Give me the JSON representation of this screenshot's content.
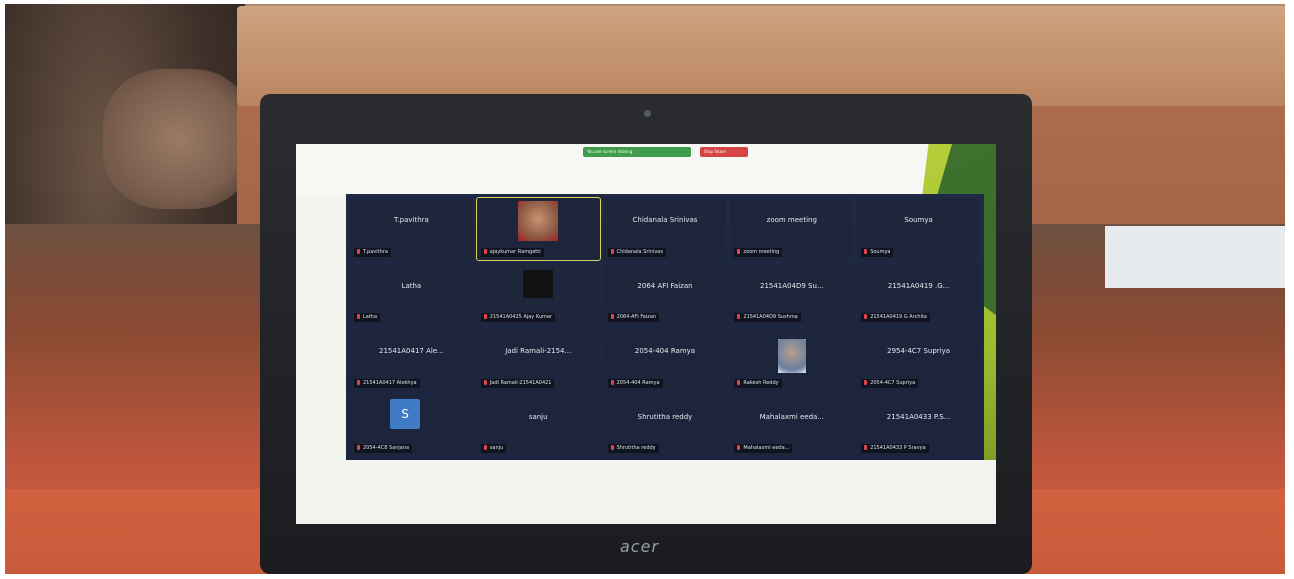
{
  "laptop": {
    "brand": "acer"
  },
  "toolbar": {
    "share_status": "You are screen sharing",
    "stop_share": "Stop Share"
  },
  "participants": [
    {
      "name": "T.pavithra",
      "label": "T.pavithra",
      "video": false
    },
    {
      "name": "",
      "label": "ajaykumar Ramgatti",
      "video": true,
      "active": true
    },
    {
      "name": "Chidanala Srinivas",
      "label": "Chidanala Srinivas",
      "video": false
    },
    {
      "name": "zoom meeting",
      "label": "zoom meeting",
      "video": false
    },
    {
      "name": "Soumya",
      "label": "Soumya",
      "video": false
    },
    {
      "name": "Latha",
      "label": "Latha",
      "video": false
    },
    {
      "name": "",
      "label": "21541A0425 Ajay Kumar",
      "logo": true
    },
    {
      "name": "2064 AFI Faizan",
      "label": "2064-AFI Faizan",
      "video": false
    },
    {
      "name": "21541A04D9 Su...",
      "label": "21541A04D9 Sushma",
      "video": false
    },
    {
      "name": "21541A0419 .G...",
      "label": "21541A0419 G Archita",
      "video": false
    },
    {
      "name": "21541A0417 Ale...",
      "label": "21541A0417 Alekhya",
      "video": false
    },
    {
      "name": "Jadi Ramali-2154...",
      "label": "Jadi Ramali-21541A0421",
      "video": false
    },
    {
      "name": "2054-404 Ramya",
      "label": "2054-404 Ramya",
      "video": false
    },
    {
      "name": "",
      "label": "Rakesh Reddy",
      "video": true,
      "small": true
    },
    {
      "name": "2954-4C7 Supriya",
      "label": "2054-4C7 Supriya",
      "video": false
    },
    {
      "name": "",
      "label": "2054-4C8 Sanjana",
      "avatar": "S"
    },
    {
      "name": "sanju",
      "label": "sanju",
      "video": false
    },
    {
      "name": "Shrutitha reddy",
      "label": "Shrutitha reddy",
      "video": false
    },
    {
      "name": "Mahalaxmi eeda...",
      "label": "Mahalaxmi eeda...",
      "video": false
    },
    {
      "name": "21541A0433 P.S...",
      "label": "21541A0433 P Sravya",
      "video": false
    }
  ],
  "colors": {
    "zoom_bg": "#1b2440",
    "mic_off": "#e2434b",
    "share_green": "#3f9d4a",
    "stop_red": "#d64545",
    "accent_green": "#9dbb2e"
  }
}
